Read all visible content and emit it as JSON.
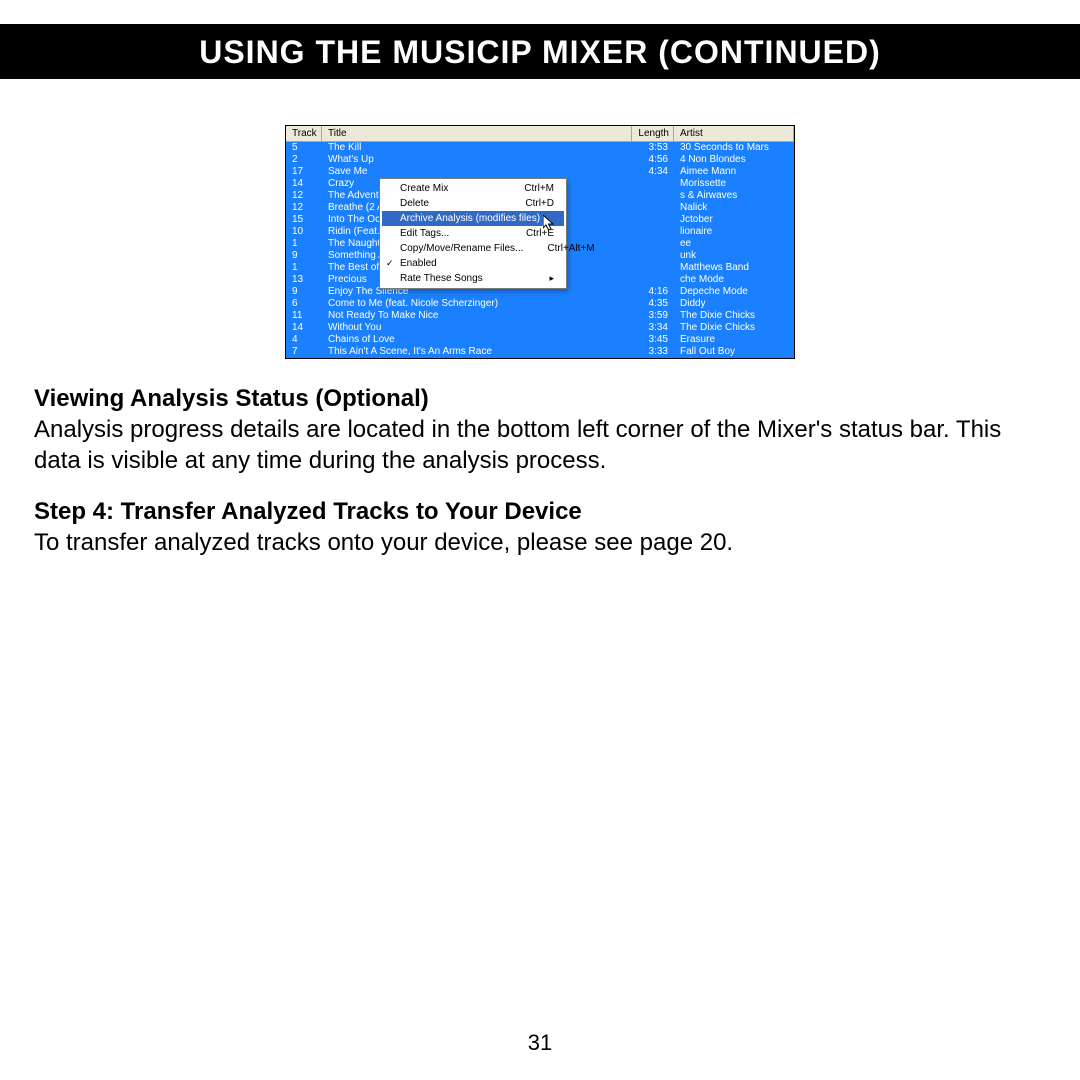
{
  "banner": "USING THE MUSICIP MIXER (CONTINUED)",
  "page_number": "31",
  "section1_heading": "Viewing Analysis Status (Optional)",
  "section1_body": "Analysis progress details are located in the bottom left corner of the Mixer's status bar. This data is visible at any time during the analysis process.",
  "section2_heading": "Step 4: Transfer Analyzed Tracks to Your Device",
  "section2_body": "To transfer analyzed tracks onto your device, please see page 20.",
  "columns": {
    "track": "Track",
    "title": "Title",
    "length": "Length",
    "artist": "Artist"
  },
  "songs": [
    {
      "track": "5",
      "title": "The Kill",
      "length": "3:53",
      "artist": "30 Seconds to Mars"
    },
    {
      "track": "2",
      "title": "What's Up",
      "length": "4:56",
      "artist": "4 Non Blondes"
    },
    {
      "track": "17",
      "title": "Save Me",
      "length": "4:34",
      "artist": "Aimee Mann"
    },
    {
      "track": "14",
      "title": "Crazy",
      "length": "",
      "artist": "Morissette"
    },
    {
      "track": "12",
      "title": "The Adventur",
      "length": "",
      "artist": "s & Airwaves"
    },
    {
      "track": "12",
      "title": "Breathe (2 AM",
      "length": "",
      "artist": "Nalick"
    },
    {
      "track": "15",
      "title": "Into The Oce",
      "length": "",
      "artist": "Jctober"
    },
    {
      "track": "10",
      "title": "Ridin (Feat. K",
      "length": "",
      "artist": "lionaire"
    },
    {
      "track": "1",
      "title": "The Naughty",
      "length": "",
      "artist": "ee"
    },
    {
      "track": "9",
      "title": "Something Ab",
      "length": "",
      "artist": "unk"
    },
    {
      "track": "1",
      "title": "The Best of V",
      "length": "",
      "artist": "Matthews Band"
    },
    {
      "track": "13",
      "title": "Precious",
      "length": "",
      "artist": "che Mode"
    },
    {
      "track": "9",
      "title": "Enjoy The Silence",
      "length": "4:16",
      "artist": "Depeche Mode"
    },
    {
      "track": "6",
      "title": "Come to Me (feat. Nicole Scherzinger)",
      "length": "4:35",
      "artist": "Diddy"
    },
    {
      "track": "11",
      "title": "Not Ready To Make Nice",
      "length": "3:59",
      "artist": "The Dixie Chicks"
    },
    {
      "track": "14",
      "title": "Without You",
      "length": "3:34",
      "artist": "The Dixie Chicks"
    },
    {
      "track": "4",
      "title": "Chains of Love",
      "length": "3:45",
      "artist": "Erasure"
    },
    {
      "track": "7",
      "title": "This Ain't A Scene, It's An Arms Race",
      "length": "3:33",
      "artist": "Fall Out Boy"
    }
  ],
  "menu": {
    "create_mix": {
      "label": "Create Mix",
      "shortcut": "Ctrl+M"
    },
    "delete": {
      "label": "Delete",
      "shortcut": "Ctrl+D"
    },
    "archive": {
      "label": "Archive Analysis (modifies files)",
      "shortcut": ""
    },
    "edit_tags": {
      "label": "Edit Tags...",
      "shortcut": "Ctrl+E"
    },
    "copy_move": {
      "label": "Copy/Move/Rename Files...",
      "shortcut": "Ctrl+Alt+M"
    },
    "enabled": {
      "label": "Enabled",
      "shortcut": ""
    },
    "rate": {
      "label": "Rate These Songs",
      "shortcut": ""
    }
  }
}
